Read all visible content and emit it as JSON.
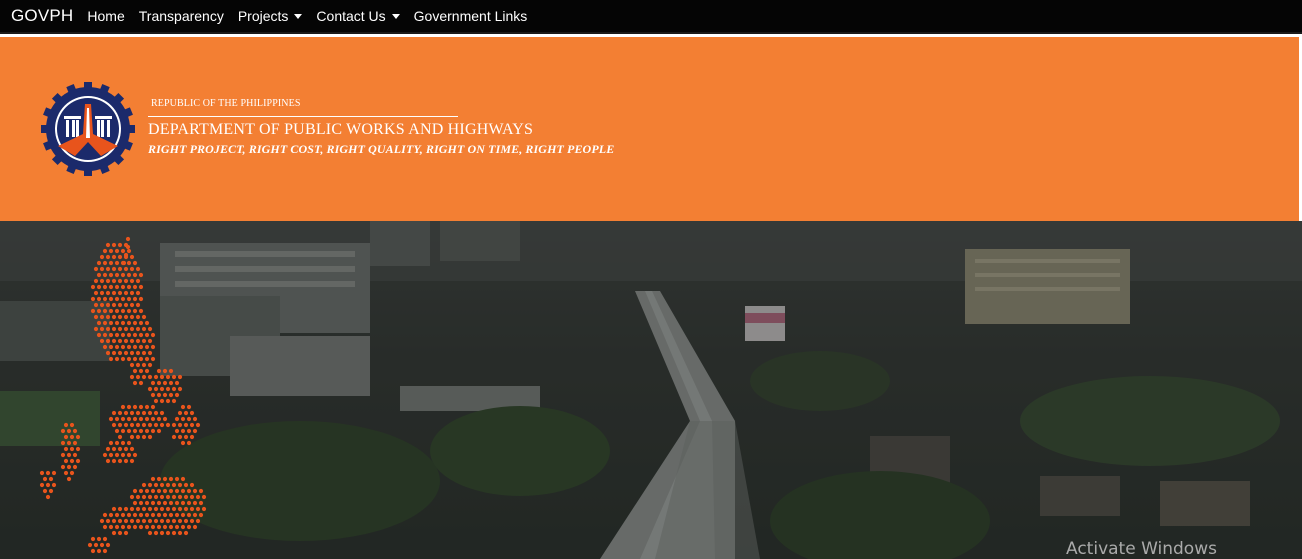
{
  "navbar": {
    "brand": "GOVPH",
    "items": [
      {
        "label": "Home",
        "dropdown": false
      },
      {
        "label": "Transparency",
        "dropdown": false
      },
      {
        "label": "Projects",
        "dropdown": true
      },
      {
        "label": "Contact Us",
        "dropdown": true
      },
      {
        "label": "Government Links",
        "dropdown": false
      }
    ]
  },
  "header": {
    "background_color": "#f37f33",
    "republic": "REPUBLIC OF THE PHILIPPINES",
    "department": "DEPARTMENT OF PUBLIC WORKS AND HIGHWAYS",
    "motto": "RIGHT PROJECT, RIGHT COST, RIGHT QUALITY, RIGHT ON TIME, RIGHT PEOPLE",
    "logo_icon": "dpwh-seal-icon"
  },
  "hero": {
    "image": "city-flyover-aerial",
    "map_icon": "philippines-dotted-map-icon",
    "map_color": "#e8541c"
  },
  "watermark": {
    "text": "Activate Windows"
  }
}
